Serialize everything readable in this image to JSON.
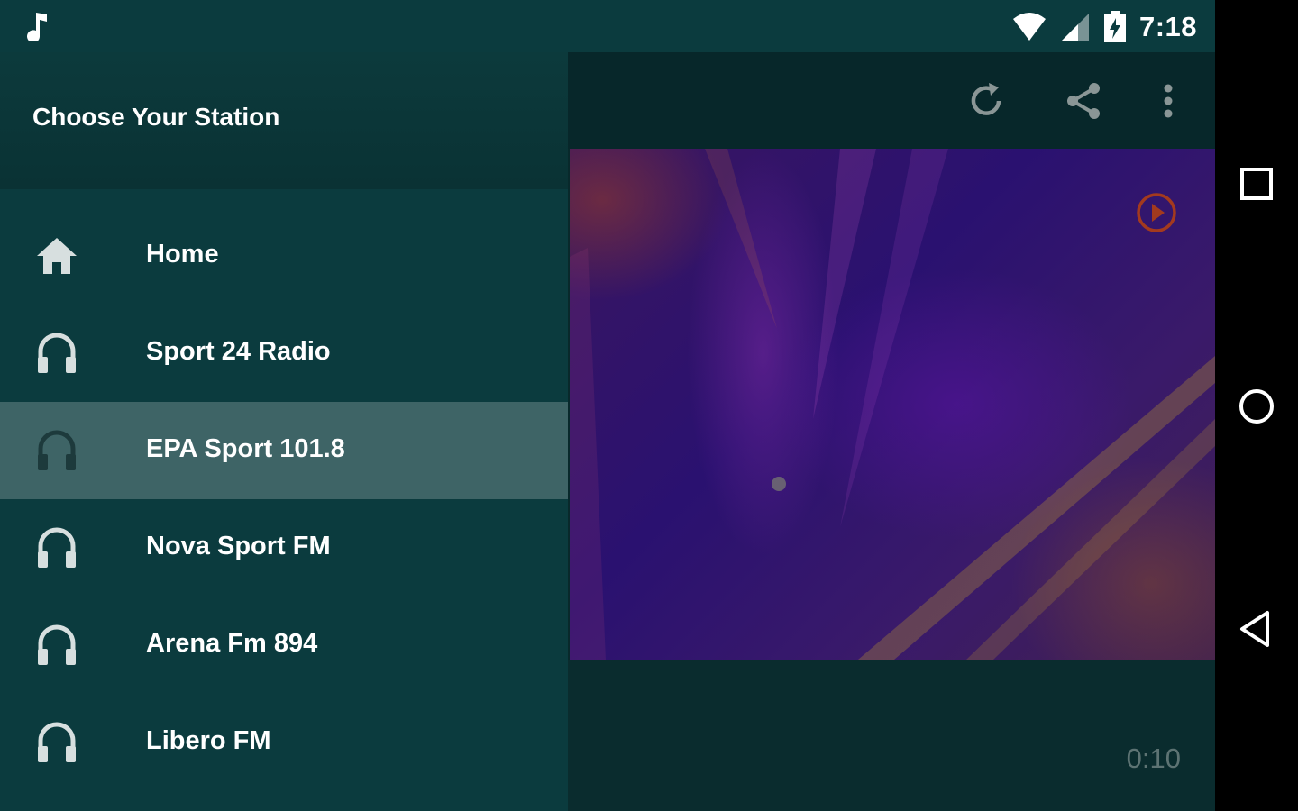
{
  "status": {
    "time": "7:18"
  },
  "drawer": {
    "title": "Choose Your Station",
    "items": [
      {
        "label": "Home",
        "icon": "home-icon",
        "selected": false
      },
      {
        "label": "Sport 24 Radio",
        "icon": "headphones-icon",
        "selected": false
      },
      {
        "label": "EPA Sport 101.8",
        "icon": "headphones-icon",
        "selected": true
      },
      {
        "label": "Nova Sport FM",
        "icon": "headphones-icon",
        "selected": false
      },
      {
        "label": "Arena Fm 894",
        "icon": "headphones-icon",
        "selected": false
      },
      {
        "label": "Libero FM",
        "icon": "headphones-icon",
        "selected": false
      }
    ]
  },
  "player": {
    "elapsed": "0:10"
  },
  "toolbar": {
    "icons": [
      "refresh-icon",
      "share-icon",
      "more-vert-icon"
    ]
  },
  "colors": {
    "drawer_bg": "#0b3b3e",
    "selected_bg": "#3e6466",
    "play_accent": "#a33a1e"
  }
}
